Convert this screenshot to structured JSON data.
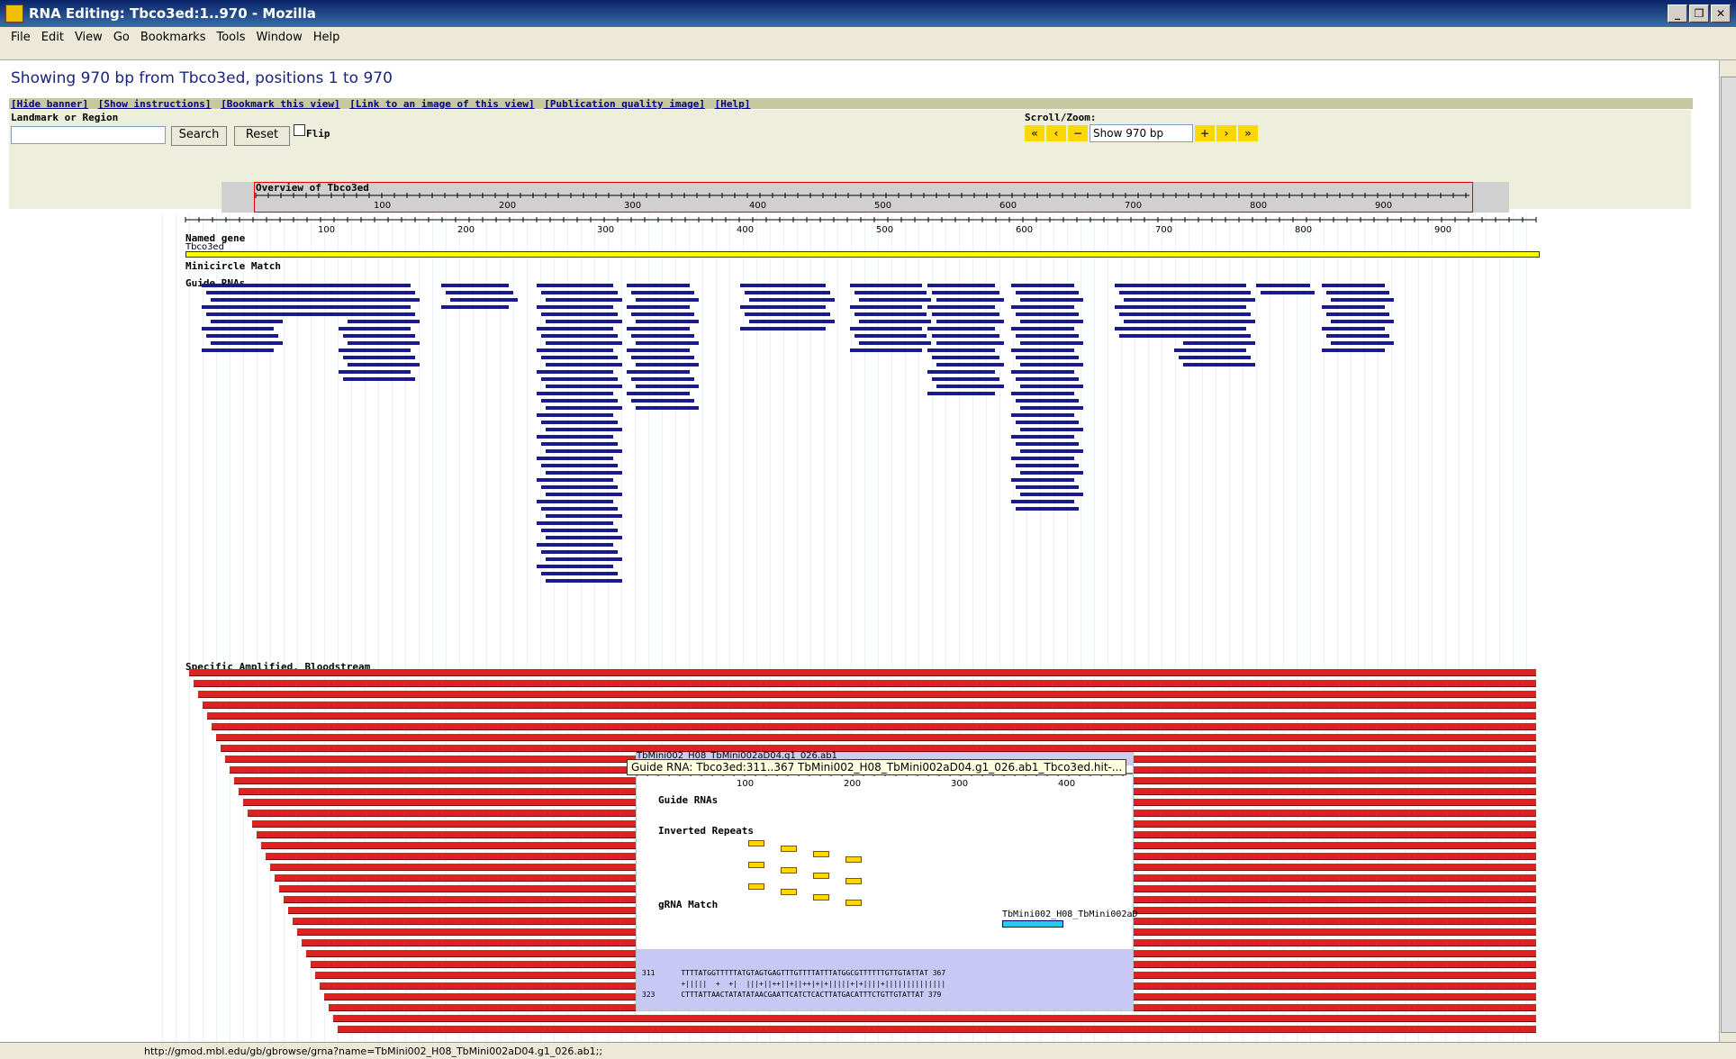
{
  "window": {
    "title": "RNA Editing: Tbco3ed:1..970 - Mozilla"
  },
  "menu": [
    "File",
    "Edit",
    "View",
    "Go",
    "Bookmarks",
    "Tools",
    "Window",
    "Help"
  ],
  "page": {
    "heading": "Showing 970 bp from Tbco3ed, positions 1 to 970",
    "links": [
      "[Hide banner]",
      "[Show instructions]",
      "[Bookmark this view]",
      "[Link to an image of this view]",
      "[Publication quality image]",
      "[Help]"
    ],
    "landmark_label": "Landmark or Region",
    "search_label": "Search",
    "reset_label": "Reset",
    "flip_label": "Flip",
    "scroll_zoom_label": "Scroll/Zoom:",
    "zoom_value": "Show 970 bp",
    "overview_title": "Overview of Tbco3ed"
  },
  "tracks": {
    "named_gene_label": "Named gene",
    "gene_name": "Tbco3ed",
    "minicircle_label": "Minicircle Match",
    "guide_rnas_label": "Guide RNAs",
    "amplified_label": "Specific Amplified, Bloodstream"
  },
  "popup": {
    "title": "TbMini002_H08_TbMini002aD04.g1_026.ab1",
    "tooltip": "Guide RNA: Tbco3ed:311..367 TbMini002_H08_TbMini002aD04.g1_026.ab1_Tbco3ed.hit-...",
    "guide_rnas_label": "Guide RNAs",
    "inverted_repeats_label": "Inverted Repeats",
    "grna_match_label": "gRNA Match",
    "grna_match_name": "TbMini002_H08_TbMini002aD",
    "seq_line1": "311      TTTTATGGTTTTTATGTAGTGAGTTTGTTTTATTTATGGCGTTTTTTGTTGTATTAT 367",
    "seq_line2": "         +|||||  +  +|  |||+||++||+||++|+|+|||||+|+||||+||||||||||||||",
    "seq_line3": "323      CTTTATTAACTATATATAACGAATTCATCTCACTTATGACATTTCTGTTGTATTAT 379"
  },
  "status": {
    "url": "http://gmod.mbl.edu/gb/gbrowse/grna?name=TbMini002_H08_TbMini002aD04.g1_026.ab1;;"
  },
  "ruler_ticks": [
    "100",
    "200",
    "300",
    "400",
    "500",
    "600",
    "700",
    "800",
    "900"
  ],
  "popup_ticks": [
    "100",
    "200",
    "300",
    "400"
  ]
}
